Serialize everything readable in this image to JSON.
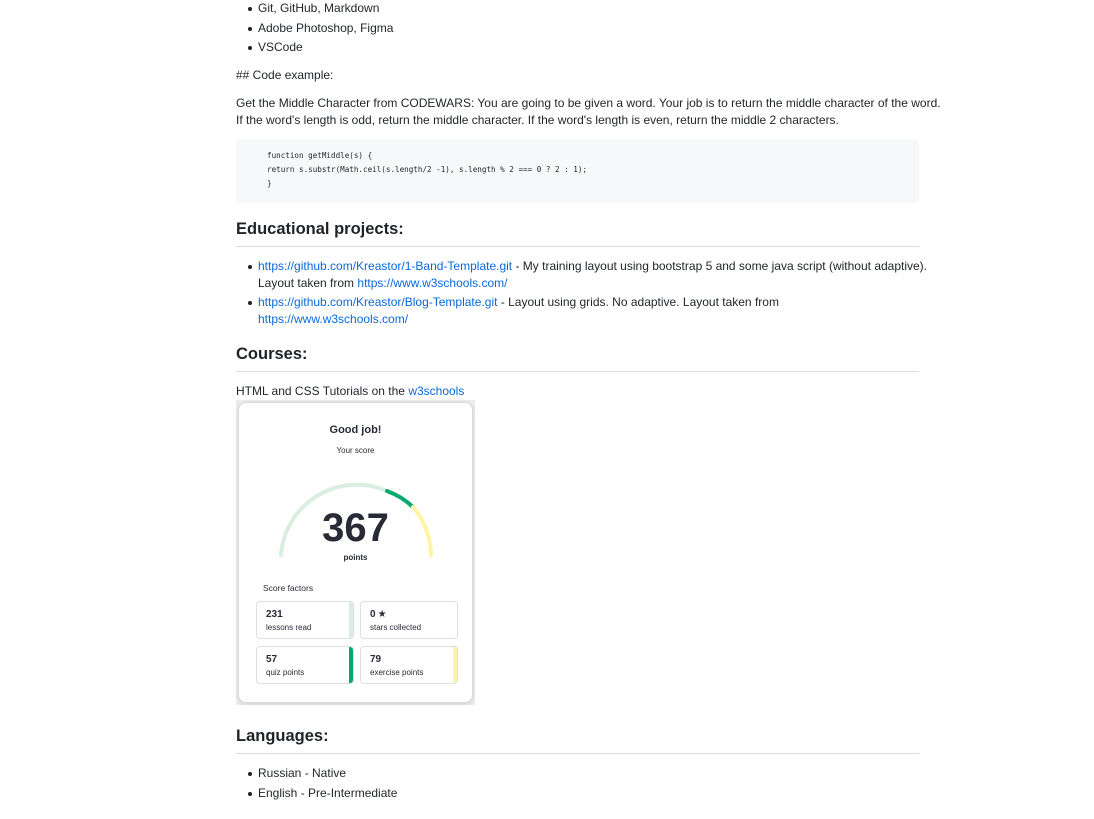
{
  "skills_tail": [
    "Git, GitHub, Markdown",
    "Adobe Photoshop, Figma",
    "VSCode"
  ],
  "code_heading": "## Code example:",
  "code_intro_line1": "Get the Middle Character from CODEWARS: You are going to be given a word. Your job is to return the middle character of the word.",
  "code_intro_line2": "If the word's length is odd, return the middle character. If the word's length is even, return the middle 2 characters.",
  "code_lines": [
    "function getMiddle(s) {",
    "return s.substr(Math.ceil(s.length/2 -1), s.length % 2 === 0 ? 2 : 1);",
    "}"
  ],
  "educational": {
    "heading": "Educational projects:",
    "items": [
      {
        "link": "https://github.com/Kreastor/1-Band-Template.git",
        "text": " - My training layout using bootstrap 5 and some java script (without adaptive).",
        "taken_from": "Layout taken from ",
        "source_link": "https://www.w3schools.com/"
      },
      {
        "link": "https://github.com/Kreastor/Blog-Template.git",
        "text": " - Layout using grids. No adaptive. Layout taken from",
        "source_link": "https://www.w3schools.com/"
      }
    ]
  },
  "courses": {
    "heading": "Courses:",
    "text": "HTML and CSS Tutorials on the ",
    "link": "w3schools"
  },
  "score_card": {
    "title": "Good job!",
    "subtitle": "Your score",
    "score": "367",
    "score_unit": "points",
    "factors_label": "Score factors",
    "factors": [
      {
        "value": "231",
        "label": "lessons read",
        "color": "#d9eee1",
        "star": false
      },
      {
        "value": "0",
        "label": "stars collected",
        "color": "#ffffff",
        "star": true
      },
      {
        "value": "57",
        "label": "quiz points",
        "color": "#04aa6d",
        "star": false
      },
      {
        "value": "79",
        "label": "exercise points",
        "color": "#fff4a3",
        "star": false
      }
    ],
    "colors": {
      "arc_base": "#d9eee1",
      "arc_green": "#04aa6d",
      "arc_yellow": "#fff4a3"
    }
  },
  "languages": {
    "heading": "Languages:",
    "items": [
      "Russian - Native",
      "English - Pre-Intermediate"
    ]
  }
}
